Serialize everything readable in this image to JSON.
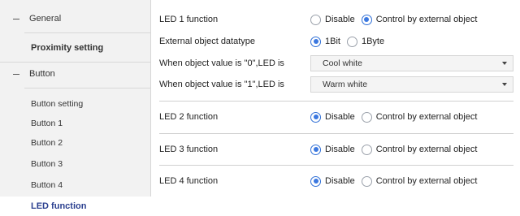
{
  "sidebar": {
    "groups": [
      {
        "label": "General"
      },
      {
        "label": "Button"
      }
    ],
    "items": [
      {
        "label": "Proximity setting"
      },
      {
        "label": "Button setting"
      },
      {
        "label": "Button 1"
      },
      {
        "label": "Button 2"
      },
      {
        "label": "Button 3"
      },
      {
        "label": "Button 4"
      },
      {
        "label": "LED function"
      }
    ]
  },
  "main": {
    "led1": {
      "label": "LED 1 function",
      "options": [
        "Disable",
        "Control by external object"
      ],
      "selected": "Control by external object"
    },
    "datatype": {
      "label": "External object datatype",
      "options": [
        "1Bit",
        "1Byte"
      ],
      "selected": "1Bit"
    },
    "value0": {
      "label": "When object value is \"0\",LED is",
      "value": "Cool white"
    },
    "value1": {
      "label": "When object value is \"1\",LED is",
      "value": "Warm white"
    },
    "led2": {
      "label": "LED 2 function",
      "options": [
        "Disable",
        "Control by external object"
      ],
      "selected": "Disable"
    },
    "led3": {
      "label": "LED 3 function",
      "options": [
        "Disable",
        "Control by external object"
      ],
      "selected": "Disable"
    },
    "led4": {
      "label": "LED 4 function",
      "options": [
        "Disable",
        "Control by external object"
      ],
      "selected": "Disable"
    }
  },
  "colors": {
    "accent": "#3b78e0",
    "active_text": "#2a3f8f",
    "sidebar_bg": "#f2f2f2"
  }
}
